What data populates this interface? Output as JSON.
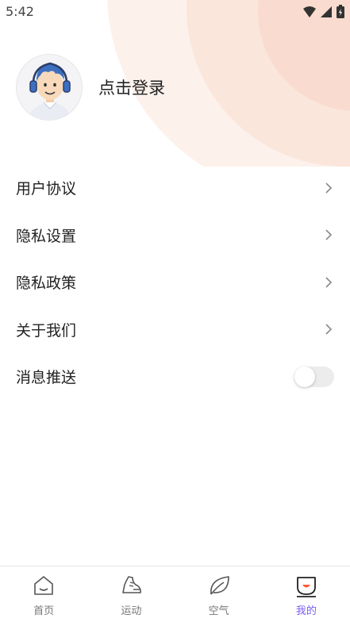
{
  "status_bar": {
    "time": "5:42"
  },
  "profile": {
    "login_text": "点击登录",
    "avatar_icon": "avatar-icon"
  },
  "menu": {
    "items": [
      {
        "label": "用户协议",
        "control": "chevron"
      },
      {
        "label": "隐私设置",
        "control": "chevron"
      },
      {
        "label": "隐私政策",
        "control": "chevron"
      },
      {
        "label": "关于我们",
        "control": "chevron"
      },
      {
        "label": "消息推送",
        "control": "toggle",
        "toggle_on": false
      }
    ]
  },
  "tabbar": {
    "tabs": [
      {
        "label": "首页",
        "icon": "home-icon",
        "active": false
      },
      {
        "label": "运动",
        "icon": "sneaker-icon",
        "active": false
      },
      {
        "label": "空气",
        "icon": "leaf-icon",
        "active": false
      },
      {
        "label": "我的",
        "icon": "profile-icon",
        "active": true
      }
    ]
  },
  "colors": {
    "accent": "#7a5cf0",
    "deco": "#fbe6dc",
    "avatar_blue": "#3d6fc0"
  }
}
